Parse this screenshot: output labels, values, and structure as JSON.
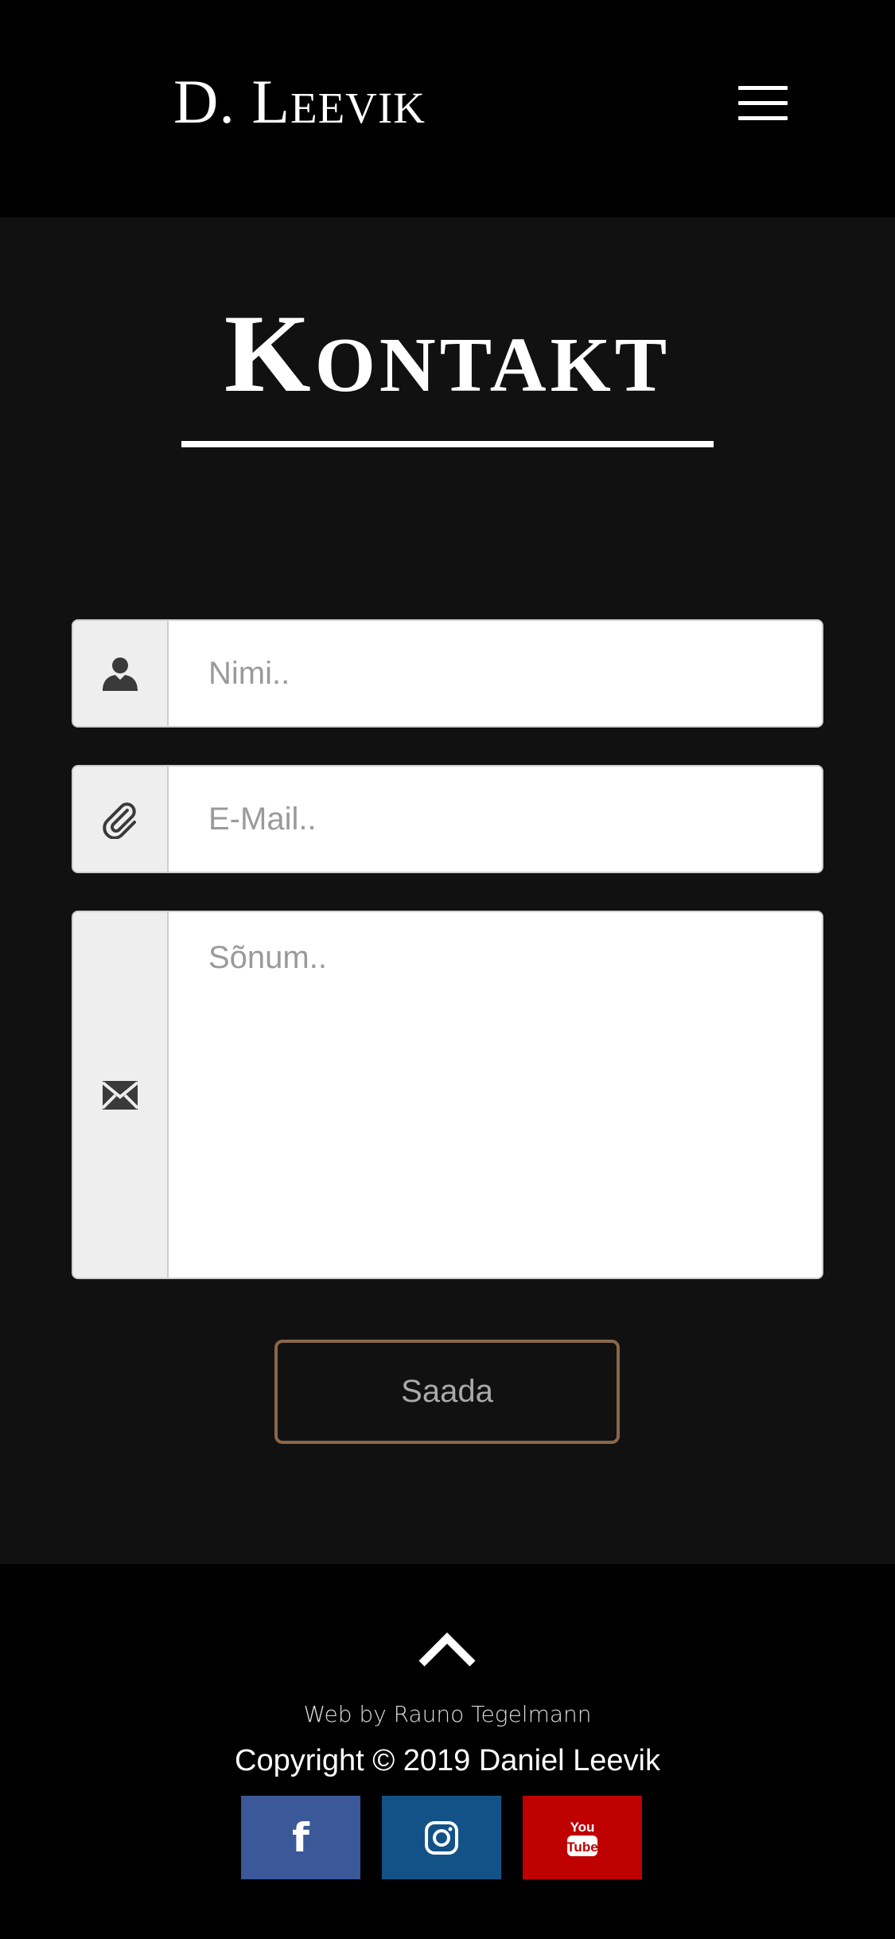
{
  "header": {
    "brand": "D. Leevik",
    "menu_icon": "hamburger-menu-icon"
  },
  "page": {
    "title": "Kontakt"
  },
  "form": {
    "name": {
      "placeholder": "Nimi..",
      "value": "",
      "icon": "user-icon"
    },
    "email": {
      "placeholder": "E-Mail..",
      "value": "",
      "icon": "paperclip-icon"
    },
    "message": {
      "placeholder": "Sõnum..",
      "value": "",
      "icon": "envelope-icon"
    },
    "submit_label": "Saada"
  },
  "footer": {
    "back_to_top_icon": "chevron-up-icon",
    "credit": "Web by Rauno Tegelmann",
    "copyright": "Copyright © 2019 Daniel Leevik",
    "social": [
      {
        "name": "facebook-icon",
        "color": "#3b5898"
      },
      {
        "name": "instagram-icon",
        "color": "#135287"
      },
      {
        "name": "youtube-icon",
        "color": "#bf0000",
        "text_top": "You",
        "text_bottom": "Tube"
      }
    ]
  },
  "colors": {
    "header_bg": "#000000",
    "page_bg": "#111111",
    "button_border": "#8a6748"
  }
}
